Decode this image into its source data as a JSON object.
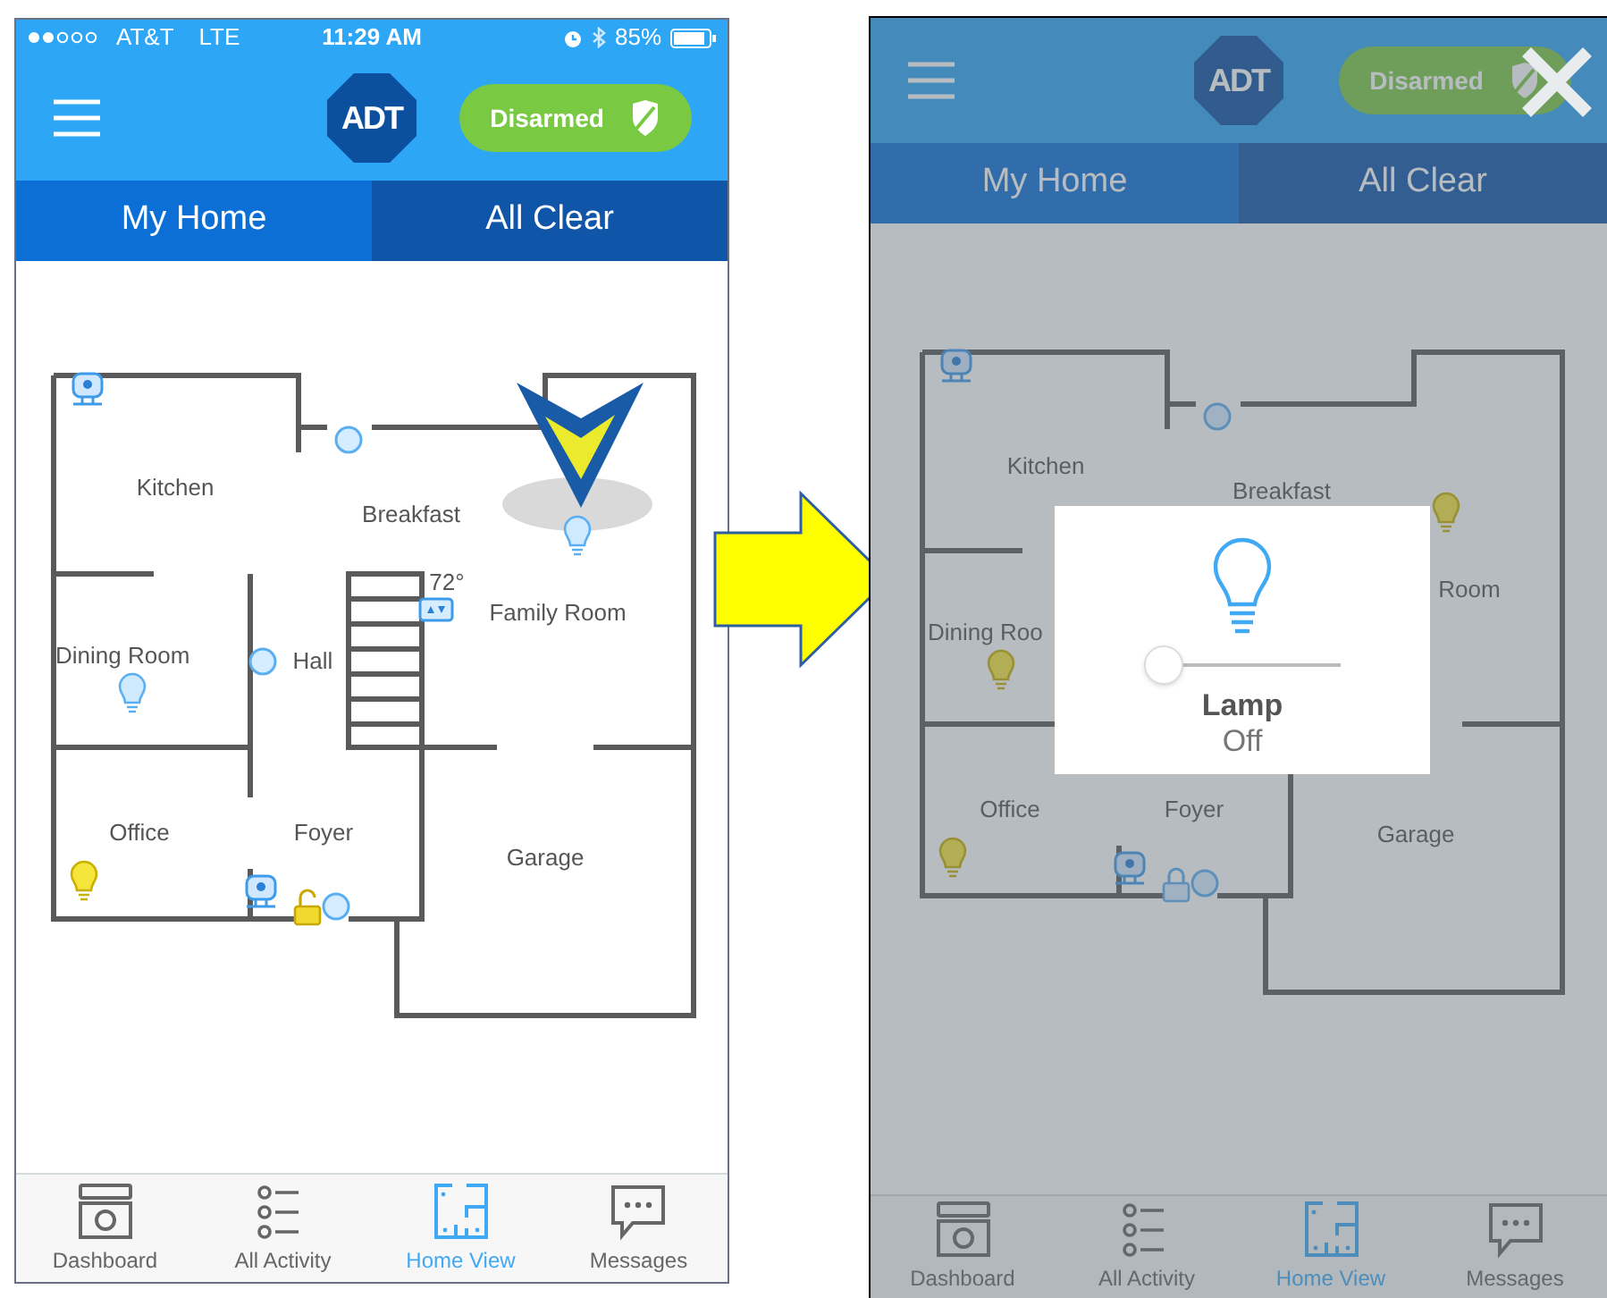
{
  "before_screen": {
    "status_bar": {
      "carrier": "AT&T",
      "network": "LTE",
      "time": "11:29 AM",
      "battery": "85%"
    },
    "header": {
      "logo": "ADT",
      "status_button": "Disarmed"
    },
    "tabs": [
      {
        "label": "My Home",
        "selected": true
      },
      {
        "label": "All Clear",
        "selected": false
      }
    ],
    "floor_plan": {
      "rooms": [
        "Kitchen",
        "Breakfast",
        "Family Room",
        "Dining Room",
        "Hall",
        "Office",
        "Foyer",
        "Garage"
      ],
      "devices": [
        {
          "kind": "camera",
          "selected": false
        },
        {
          "kind": "sensor",
          "selected": false
        },
        {
          "kind": "light",
          "on": false,
          "selected": true
        },
        {
          "kind": "thermostat",
          "reading": "72°",
          "selected": false
        },
        {
          "kind": "light",
          "on": false,
          "selected": false
        },
        {
          "kind": "sensor",
          "selected": false
        },
        {
          "kind": "light",
          "on": true,
          "selected": false
        },
        {
          "kind": "camera",
          "selected": false
        },
        {
          "kind": "lock",
          "locked": false,
          "selected": false
        },
        {
          "kind": "sensor",
          "selected": false
        }
      ]
    },
    "bottom_tabs": [
      {
        "label": "Dashboard",
        "selected": false
      },
      {
        "label": "All Activity",
        "selected": false
      },
      {
        "label": "Home View",
        "selected": true
      },
      {
        "label": "Messages",
        "selected": false
      }
    ]
  },
  "after_screen": {
    "header": {
      "logo": "ADT",
      "status_button": "Disarmed"
    },
    "tabs": [
      {
        "label": "My Home",
        "selected": true
      },
      {
        "label": "All Clear",
        "selected": false
      }
    ],
    "floor_plan": {
      "rooms": [
        "Kitchen",
        "Breakfast",
        "Dining Roo",
        "Room",
        "Office",
        "Foyer",
        "Garage"
      ],
      "devices": [
        {
          "kind": "camera",
          "selected": false
        },
        {
          "kind": "sensor",
          "selected": false
        },
        {
          "kind": "light",
          "on": true,
          "selected": false
        },
        {
          "kind": "light",
          "on": true,
          "selected": false
        },
        {
          "kind": "light",
          "on": true,
          "selected": false
        },
        {
          "kind": "camera",
          "selected": false
        },
        {
          "kind": "lock",
          "locked": true,
          "selected": false
        },
        {
          "kind": "sensor",
          "selected": false
        }
      ]
    },
    "dialog": {
      "title": "Lamp",
      "state": "Off",
      "level": 0
    },
    "bottom_tabs": [
      {
        "label": "Dashboard",
        "selected": false
      },
      {
        "label": "All Activity",
        "selected": false
      },
      {
        "label": "Home View",
        "selected": true
      },
      {
        "label": "Messages",
        "selected": false
      }
    ]
  }
}
